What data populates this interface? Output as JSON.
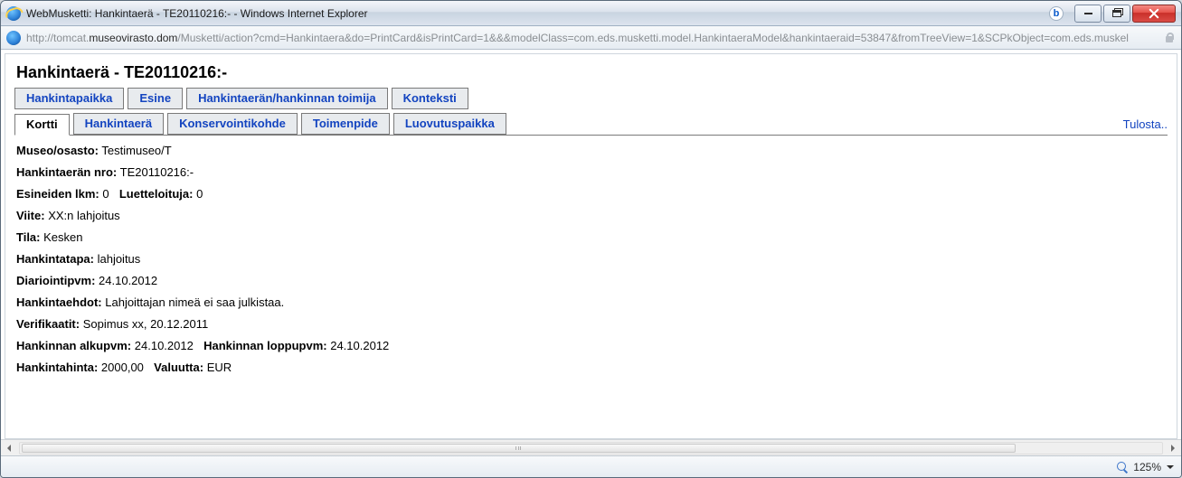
{
  "window": {
    "title": "WebMusketti: Hankintaerä - TE20110216:- - Windows Internet Explorer",
    "url_prefix": "http://tomcat.",
    "url_strong": "museovirasto.dom",
    "url_suffix": "/Musketti/action?cmd=Hankintaera&do=PrintCard&isPrintCard=1&&&modelClass=com.eds.musketti.model.HankintaeraModel&hankintaeraid=53847&fromTreeView=1&SCPkObject=com.eds.muskel",
    "bing_badge": "b"
  },
  "heading": "Hankintaerä  - TE20110216:-",
  "tabs_row1": [
    "Hankintapaikka",
    "Esine",
    "Hankintaerän/hankinnan toimija",
    "Konteksti"
  ],
  "tabs_row2": [
    "Kortti",
    "Hankintaerä",
    "Konservointikohde",
    "Toimenpide",
    "Luovutuspaikka"
  ],
  "active_tab_row2_index": 0,
  "print_link": "Tulosta..",
  "fields": {
    "museo_label": "Museo/osasto:",
    "museo_value": "Testimuseo/T",
    "nro_label": "Hankintaerän nro:",
    "nro_value": "TE20110216:-",
    "lkm_label": "Esineiden lkm:",
    "lkm_value": "0",
    "luetteloituja_label": "Luetteloituja:",
    "luetteloituja_value": "0",
    "viite_label": "Viite:",
    "viite_value": "XX:n lahjoitus",
    "tila_label": "Tila:",
    "tila_value": "Kesken",
    "tapa_label": "Hankintatapa:",
    "tapa_value": "lahjoitus",
    "diar_label": "Diariointipvm:",
    "diar_value": "24.10.2012",
    "ehdot_label": "Hankintaehdot:",
    "ehdot_value": "Lahjoittajan nimeä ei saa julkistaa.",
    "verif_label": "Verifikaatit:",
    "verif_value": "Sopimus xx, 20.12.2011",
    "alku_label": "Hankinnan alkupvm:",
    "alku_value": "24.10.2012",
    "loppu_label": "Hankinnan loppupvm:",
    "loppu_value": "24.10.2012",
    "hinta_label": "Hankintahinta:",
    "hinta_value": "2000,00",
    "valuutta_label": "Valuutta:",
    "valuutta_value": "EUR"
  },
  "statusbar": {
    "zoom": "125%"
  }
}
